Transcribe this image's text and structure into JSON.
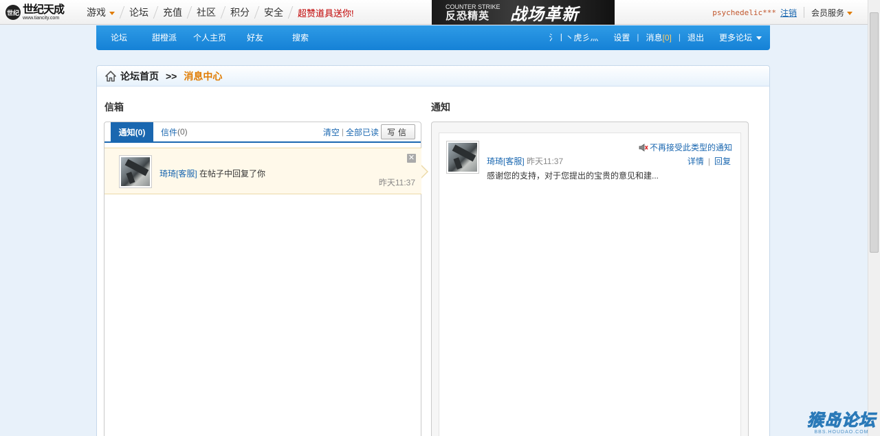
{
  "topbar": {
    "logo_text": "世纪天成",
    "logo_url_text": "www.tiancity.com",
    "logo_mark": "世纪",
    "nav": [
      "游戏",
      "论坛",
      "充值",
      "社区",
      "积分",
      "安全"
    ],
    "promo": "超赞道具送你!",
    "banner": {
      "cs_small": "COUNTER STRIKE",
      "cs_name": "反恐精英",
      "slogan": "战场革新"
    },
    "username": "psychedelic***",
    "logout": "注销",
    "member_service": "会员服务"
  },
  "bluenav": {
    "tabs": [
      "论坛",
      "甜橙派",
      "个人主页",
      "好友",
      "搜索"
    ],
    "user": "氵丨丶虎彡灬",
    "settings": "设置",
    "messages_label": "消息",
    "messages_count": "[0]",
    "exit": "退出",
    "more": "更多论坛"
  },
  "breadcrumb": {
    "home": "论坛首页",
    "arrow": ">>",
    "current": "消息中心"
  },
  "inbox": {
    "title": "信箱",
    "tab_notice": "通知(0)",
    "tab_letter_label": "信件",
    "tab_letter_count": "(0)",
    "clear": "清空",
    "mark_all_read": "全部已读",
    "write": "写信",
    "item": {
      "sender": "琦琦[客服]",
      "text": " 在帖子中回复了你",
      "time": "昨天11:37"
    }
  },
  "notify": {
    "title": "通知",
    "block_link": "不再接受此类型的通知",
    "sender": "琦琦[客服]",
    "time": " 昨天11:37",
    "detail": "详情",
    "reply": "回复",
    "content": "感谢您的支持，对于您提出的宝贵的意见和建..."
  },
  "watermark": {
    "big": "猴岛论坛",
    "small": "BBS.HOUDAO.COM"
  }
}
